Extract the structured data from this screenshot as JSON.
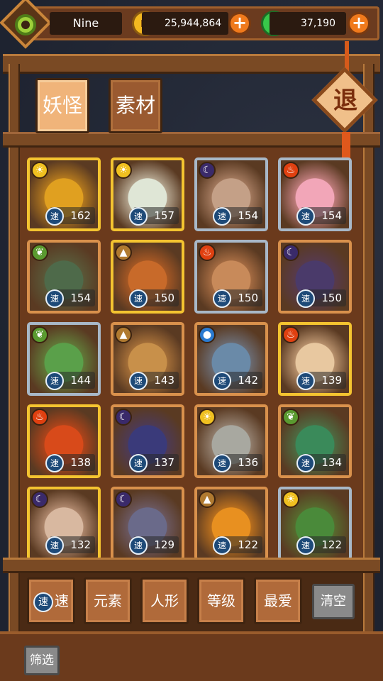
{
  "player": {
    "name": "Nine"
  },
  "resources": {
    "gold": "25,944,864",
    "jade": "37,190"
  },
  "tabs": [
    {
      "label": "妖怪",
      "active": true
    },
    {
      "label": "素材",
      "active": false
    }
  ],
  "exit_label": "退",
  "speed_icon_char": "速",
  "monsters": [
    {
      "element": "sun",
      "speed": "162",
      "frame": "gold",
      "art": "#e0a020"
    },
    {
      "element": "sun",
      "speed": "157",
      "frame": "gold",
      "art": "#dfe6d6"
    },
    {
      "element": "moon",
      "speed": "154",
      "frame": "blue",
      "art": "#c4a087"
    },
    {
      "element": "fire",
      "speed": "154",
      "frame": "blue",
      "art": "#f2a6b8"
    },
    {
      "element": "leaf",
      "speed": "154",
      "frame": "orange",
      "art": "#4e6a4a"
    },
    {
      "element": "earth",
      "speed": "150",
      "frame": "gold",
      "art": "#c86a2a"
    },
    {
      "element": "fire",
      "speed": "150",
      "frame": "blue",
      "art": "#c88a5a"
    },
    {
      "element": "moon",
      "speed": "150",
      "frame": "orange",
      "art": "#4a3a6a"
    },
    {
      "element": "leaf",
      "speed": "144",
      "frame": "blue",
      "art": "#5aa04a"
    },
    {
      "element": "earth",
      "speed": "143",
      "frame": "orange",
      "art": "#c8904a"
    },
    {
      "element": "water",
      "speed": "142",
      "frame": "orange",
      "art": "#6a8aa8"
    },
    {
      "element": "fire",
      "speed": "139",
      "frame": "gold",
      "art": "#e8c8a0"
    },
    {
      "element": "fire",
      "speed": "138",
      "frame": "gold",
      "art": "#d84a1a"
    },
    {
      "element": "moon",
      "speed": "137",
      "frame": "orange",
      "art": "#3a3a7a"
    },
    {
      "element": "sun",
      "speed": "136",
      "frame": "orange",
      "art": "#a8a8a0"
    },
    {
      "element": "leaf",
      "speed": "134",
      "frame": "orange",
      "art": "#3a8a5a"
    },
    {
      "element": "moon",
      "speed": "132",
      "frame": "gold",
      "art": "#d8b8a0"
    },
    {
      "element": "moon",
      "speed": "129",
      "frame": "orange",
      "art": "#6a6a8a"
    },
    {
      "element": "earth",
      "speed": "122",
      "frame": "orange",
      "art": "#e89020"
    },
    {
      "element": "sun",
      "speed": "122",
      "frame": "blue",
      "art": "#4a8a3a"
    }
  ],
  "element_colors": {
    "sun": "#f0c020",
    "moon": "#3a2a6a",
    "fire": "#e04010",
    "leaf": "#5a9a30",
    "earth": "#b07a30",
    "water": "#2a7ad0"
  },
  "filter": {
    "speed_icon": "速",
    "speed": "速",
    "element": "元素",
    "humanoid": "人形",
    "level": "等级",
    "favorite": "最爱",
    "clear": "清空",
    "screen": "筛选"
  }
}
